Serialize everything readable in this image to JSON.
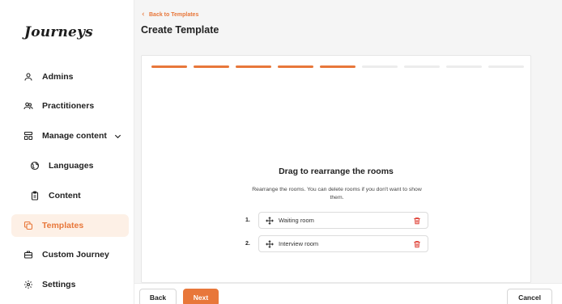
{
  "app": {
    "logo_text": "Journeys"
  },
  "sidebar": {
    "items": [
      {
        "label": "Admins",
        "icon": "user-icon"
      },
      {
        "label": "Practitioners",
        "icon": "users-icon"
      },
      {
        "label": "Manage content",
        "icon": "layout-icon",
        "expanded": true
      },
      {
        "label": "Languages",
        "icon": "globe-icon"
      },
      {
        "label": "Content",
        "icon": "clipboard-icon"
      },
      {
        "label": "Templates",
        "icon": "copy-icon",
        "active": true
      },
      {
        "label": "Custom Journey",
        "icon": "briefcase-icon"
      },
      {
        "label": "Settings",
        "icon": "gear-icon"
      }
    ]
  },
  "header": {
    "back_link": "Back to Templates",
    "title": "Create Template"
  },
  "wizard": {
    "progress": {
      "total_steps": 9,
      "completed_steps": 5
    },
    "step_title": "Drag to rearrange the rooms",
    "step_description": "Rearrange the rooms. You can delete rooms if you don't want to show them.",
    "rooms": [
      {
        "number": "1.",
        "name": "Waiting room"
      },
      {
        "number": "2.",
        "name": "Interview room"
      }
    ]
  },
  "footer": {
    "back_label": "Back",
    "next_label": "Next",
    "cancel_label": "Cancel"
  },
  "colors": {
    "accent": "#e8773a",
    "accent_light": "#fdf0e6",
    "delete_icon": "#e0453a"
  }
}
